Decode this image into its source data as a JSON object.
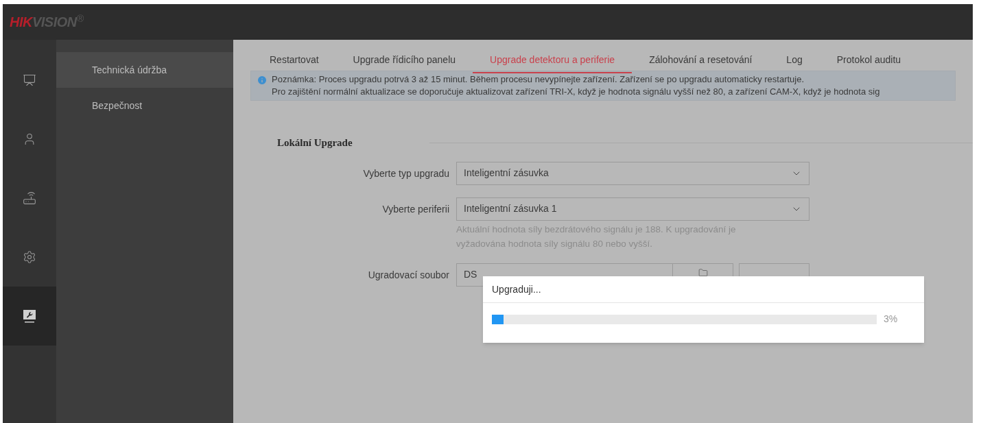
{
  "logo": {
    "brand_red": "HIK",
    "brand_grey": "VISION",
    "mark": "®"
  },
  "rail": [
    {
      "kind": "dashboard",
      "selected": false
    },
    {
      "kind": "user",
      "selected": false
    },
    {
      "kind": "device",
      "selected": false
    },
    {
      "kind": "settings",
      "selected": false
    },
    {
      "kind": "maintenance",
      "selected": true
    }
  ],
  "submenu": [
    {
      "label": "Technická údržba",
      "selected": true
    },
    {
      "label": "Bezpečnost",
      "selected": false
    }
  ],
  "tabs": [
    {
      "label": "Restartovat",
      "selected": false
    },
    {
      "label": "Upgrade řídicího panelu",
      "selected": false
    },
    {
      "label": "Upgrade detektoru a periferie",
      "selected": true
    },
    {
      "label": "Zálohování a resetování",
      "selected": false
    },
    {
      "label": "Log",
      "selected": false
    },
    {
      "label": "Protokol auditu",
      "selected": false
    }
  ],
  "note": {
    "lines": [
      "Poznámka: Proces upgradu potrvá 3 až 15 minut. Během procesu nevypínejte zařízení. Zařízení se po upgradu automaticky restartuje.",
      "Pro zajištění normální aktualizace se doporučuje aktualizovat zařízení TRI-X, když je hodnota signálu vyšší než 80, a zařízení CAM-X, když je hodnota sig"
    ]
  },
  "section": {
    "title": "Lokální Upgrade"
  },
  "form": [
    {
      "label": "Vyberte typ upgradu",
      "value": "Inteligentní zásuvka"
    },
    {
      "label": "Vyberte periferii",
      "value": "Inteligentní zásuvka 1",
      "hint": "Aktuální hodnota síly bezdrátového signálu je 188. K upgradování je vyžadována hodnota síly signálu 80 nebo vyšší."
    }
  ],
  "file_row": {
    "label": "Ugradovací soubor",
    "value": "DS"
  },
  "dialog": {
    "title": "Upgraduji...",
    "level": 0.03,
    "reading": "3%"
  }
}
